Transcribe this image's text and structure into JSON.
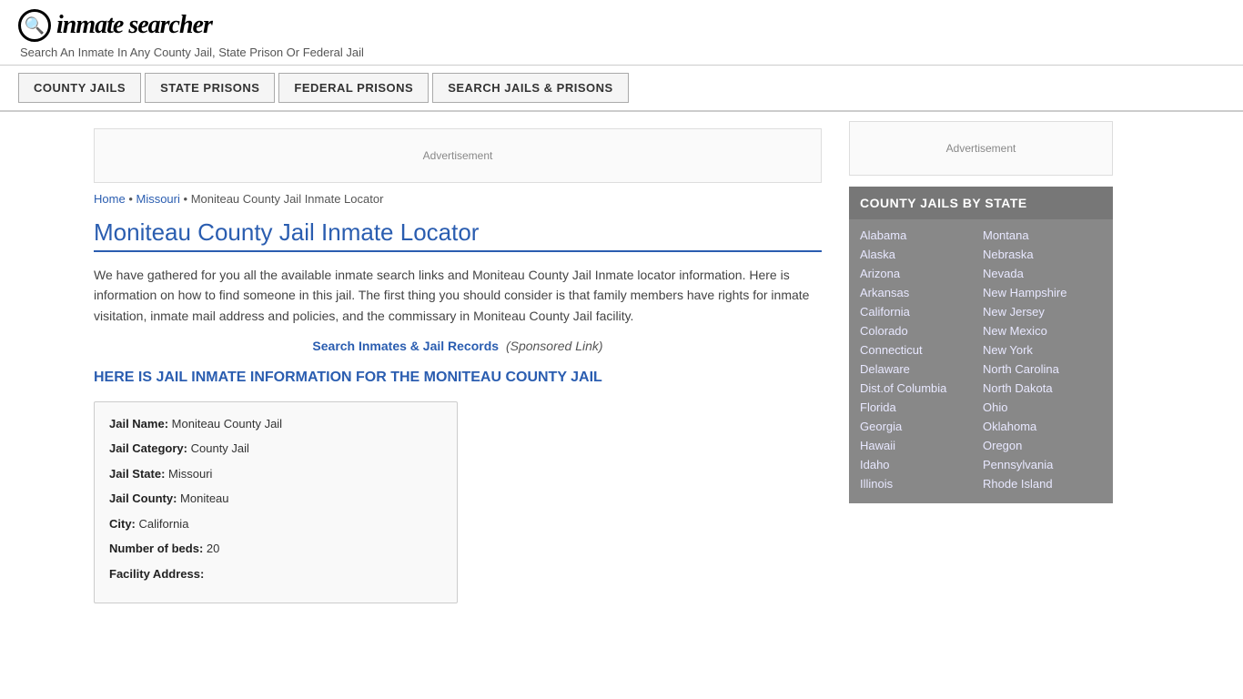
{
  "header": {
    "logo_symbol": "🔍",
    "logo_text": "inmate searcher",
    "tagline": "Search An Inmate In Any County Jail, State Prison Or Federal Jail"
  },
  "nav": {
    "items": [
      "COUNTY JAILS",
      "STATE PRISONS",
      "FEDERAL PRISONS",
      "SEARCH JAILS & PRISONS"
    ]
  },
  "ad": {
    "label": "Advertisement"
  },
  "breadcrumb": {
    "home": "Home",
    "state": "Missouri",
    "current": "Moniteau County Jail Inmate Locator"
  },
  "page": {
    "title": "Moniteau County Jail Inmate Locator",
    "description": "We have gathered for you all the available inmate search links and Moniteau County Jail Inmate locator information. Here is information on how to find someone in this jail. The first thing you should consider is that family members have rights for inmate visitation, inmate mail address and policies, and the commissary in Moniteau County Jail facility.",
    "sponsored_link_text": "Search Inmates & Jail Records",
    "sponsored_label": "(Sponsored Link)",
    "subheading": "HERE IS JAIL INMATE INFORMATION FOR THE MONITEAU COUNTY JAIL"
  },
  "jail_info": {
    "name_label": "Jail Name:",
    "name_value": "Moniteau County Jail",
    "category_label": "Jail Category:",
    "category_value": "County Jail",
    "state_label": "Jail State:",
    "state_value": "Missouri",
    "county_label": "Jail County:",
    "county_value": "Moniteau",
    "city_label": "City:",
    "city_value": "California",
    "beds_label": "Number of beds:",
    "beds_value": "20",
    "address_label": "Facility Address:"
  },
  "sidebar": {
    "ad_label": "Advertisement",
    "section_title": "COUNTY JAILS BY STATE",
    "states_col1": [
      "Alabama",
      "Alaska",
      "Arizona",
      "Arkansas",
      "California",
      "Colorado",
      "Connecticut",
      "Delaware",
      "Dist.of Columbia",
      "Florida",
      "Georgia",
      "Hawaii",
      "Idaho",
      "Illinois"
    ],
    "states_col2": [
      "Montana",
      "Nebraska",
      "Nevada",
      "New Hampshire",
      "New Jersey",
      "New Mexico",
      "New York",
      "North Carolina",
      "North Dakota",
      "Ohio",
      "Oklahoma",
      "Oregon",
      "Pennsylvania",
      "Rhode Island"
    ]
  }
}
